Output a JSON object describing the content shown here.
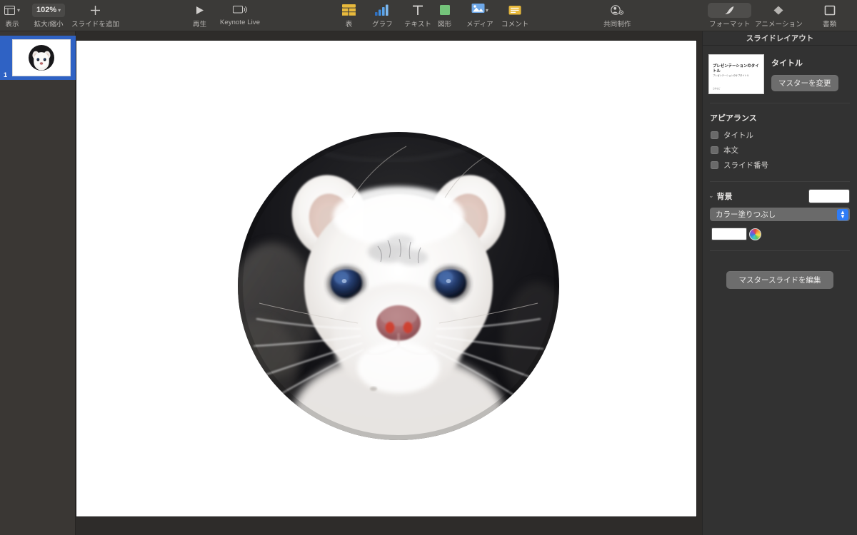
{
  "app": {
    "name": "Keynote"
  },
  "toolbar": {
    "left_items": [
      {
        "id": "view",
        "label": "表示",
        "icon": "window-icon",
        "has_chevron": true
      },
      {
        "id": "zoom",
        "label": "拡大/縮小",
        "icon": "zoom-value",
        "value": "102%",
        "has_chevron": true
      },
      {
        "id": "add-slide",
        "label": "スライドを追加",
        "icon": "plus-icon",
        "has_chevron": false
      }
    ],
    "play_items": [
      {
        "id": "play",
        "label": "再生",
        "icon": "play-icon"
      },
      {
        "id": "keynote-live",
        "label": "Keynote Live",
        "icon": "display-icon"
      }
    ],
    "insert_items": [
      {
        "id": "table",
        "label": "表",
        "icon": "table-icon",
        "color": "#e8b93c",
        "has_chevron": false
      },
      {
        "id": "chart",
        "label": "グラフ",
        "icon": "chart-icon",
        "color": "#3f8ee0",
        "has_chevron": false
      },
      {
        "id": "text",
        "label": "テキスト",
        "icon": "text-icon",
        "color": "#d8d6d4",
        "has_chevron": false
      },
      {
        "id": "shape",
        "label": "図形",
        "icon": "shape-icon",
        "color": "#74c47a",
        "has_chevron": false
      },
      {
        "id": "media",
        "label": "メディア",
        "icon": "media-icon",
        "color": "#6ea8e8",
        "has_chevron": true
      },
      {
        "id": "comment",
        "label": "コメント",
        "icon": "comment-icon",
        "color": "#e8b93c",
        "has_chevron": false
      }
    ],
    "collab": {
      "id": "collaborate",
      "label": "共同制作",
      "icon": "collaborate-icon"
    },
    "right_items": [
      {
        "id": "format",
        "label": "フォーマット",
        "icon": "format-brush-icon",
        "selected": true
      },
      {
        "id": "animate",
        "label": "アニメーション",
        "icon": "animate-diamond-icon",
        "selected": false
      },
      {
        "id": "document",
        "label": "書類",
        "icon": "document-icon",
        "selected": false
      }
    ]
  },
  "navigator": {
    "slides": [
      {
        "number": "1",
        "name": "slide-thumbnail-1",
        "selected": true
      }
    ]
  },
  "canvas": {
    "slide_background": "#ffffff",
    "image": {
      "name": "ermine-photo",
      "alt": "オコジョの顔のクローズアップ写真（円形マスク）",
      "mask": "circle"
    }
  },
  "inspector": {
    "title": "スライドレイアウト",
    "layout": {
      "thumbnail": {
        "title": "プレゼンテーションのタイトル",
        "subtitle": "プレゼンテーションのサブタイトル",
        "footer": "日付など"
      },
      "name": "タイトル",
      "change_master_button": "マスターを変更"
    },
    "appearance": {
      "heading": "アピアランス",
      "options": [
        {
          "label": "タイトル",
          "checked": false
        },
        {
          "label": "本文",
          "checked": false
        },
        {
          "label": "スライド番号",
          "checked": false
        }
      ]
    },
    "background": {
      "heading": "背景",
      "expanded": true,
      "preview_color": "#ffffff",
      "fill_type": "カラー塗りつぶし",
      "color_value": "#ffffff"
    },
    "edit_master_button": "マスタースライドを編集"
  },
  "colors": {
    "toolbar_bg": "#3b3a38",
    "navigator_bg": "#3a3734",
    "canvas_bg": "#2e2c2a",
    "inspector_bg": "#323232",
    "selection_blue": "#2f62c4",
    "stepper_blue": "#2f7cf6"
  }
}
